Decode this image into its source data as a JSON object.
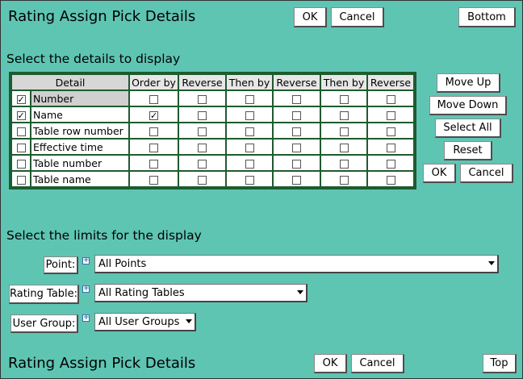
{
  "header": {
    "title": "Rating Assign Pick Details",
    "ok_label": "OK",
    "cancel_label": "Cancel",
    "bottom_label": "Bottom"
  },
  "details": {
    "section_title": "Select the details to display",
    "columns": [
      "Detail",
      "Order by",
      "Reverse",
      "Then by",
      "Reverse",
      "Then by",
      "Reverse"
    ],
    "rows": [
      {
        "label": "Number",
        "checked": true,
        "flags": [
          false,
          false,
          false,
          false,
          false,
          false
        ],
        "selected": true
      },
      {
        "label": "Name",
        "checked": true,
        "flags": [
          true,
          false,
          false,
          false,
          false,
          false
        ],
        "selected": false
      },
      {
        "label": "Table row number",
        "checked": false,
        "flags": [
          false,
          false,
          false,
          false,
          false,
          false
        ],
        "selected": false
      },
      {
        "label": "Effective time",
        "checked": false,
        "flags": [
          false,
          false,
          false,
          false,
          false,
          false
        ],
        "selected": false
      },
      {
        "label": "Table number",
        "checked": false,
        "flags": [
          false,
          false,
          false,
          false,
          false,
          false
        ],
        "selected": false
      },
      {
        "label": "Table name",
        "checked": false,
        "flags": [
          false,
          false,
          false,
          false,
          false,
          false
        ],
        "selected": false
      }
    ],
    "side_buttons": {
      "move_up": "Move Up",
      "move_down": "Move Down",
      "select_all": "Select All",
      "reset": "Reset",
      "ok": "OK",
      "cancel": "Cancel"
    }
  },
  "limits": {
    "section_title": "Select the limits for the display",
    "point": {
      "label": "Point:",
      "value": "All Points"
    },
    "rating_table": {
      "label": "Rating Table:",
      "value": "All Rating Tables"
    },
    "user_group": {
      "label": "User Group:",
      "value": "All User Groups"
    },
    "expand_glyph": "+"
  },
  "footer": {
    "title": "Rating Assign Pick Details",
    "ok_label": "OK",
    "cancel_label": "Cancel",
    "top_label": "Top"
  }
}
